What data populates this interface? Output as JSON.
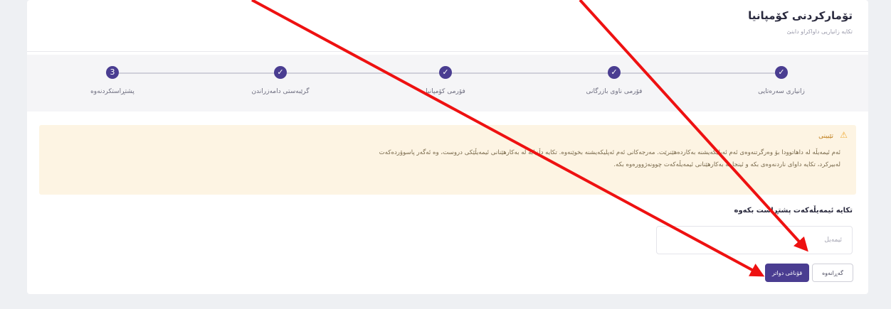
{
  "header": {
    "title": "تۆمارکردنی کۆمپانیا",
    "subtitle": "تکایە زانیاریی داواکراو دابنێ"
  },
  "steps": [
    {
      "label": "زانیاری سەرەتایی",
      "done": true,
      "mark": "✓"
    },
    {
      "label": "فۆرمی ناوی بازرگانی",
      "done": true,
      "mark": "✓"
    },
    {
      "label": "فۆرمی کۆمپانیا",
      "done": true,
      "mark": "✓"
    },
    {
      "label": "گرێبەستی دامەزراندن",
      "done": true,
      "mark": "✓"
    },
    {
      "label": "پشتڕاستکردنەوە",
      "done": false,
      "mark": "3"
    }
  ],
  "notice": {
    "title": "تێبینی",
    "body": "ئەم ئیمەیڵە لە داهاتوودا بۆ وەرگرتنەوەی ئەم ئەپلیکەیشنە بەکاردەهێنرێت. مەرجەکانی ئەم ئەپلیکەیشنە بخوێنەوە. تکایە دڵنیابە لە بەکارهێنانی ئیمەیڵێکی دروست، وە ئەگەر پاسوۆردەکەت لەبیرکرد، تکایە داوای ناردنەوەی بکە و ئینجا بە بەکارهێنانی ئیمەیڵەکەت چوونەژوورەوە بکە."
  },
  "question": "تکایە ئیمەیڵەکەت پشتڕاست بکەوە",
  "form": {
    "email_value": "",
    "email_placeholder": "ئیمەیڵ"
  },
  "buttons": {
    "next_label": "قۆناغی دواتر",
    "back_label": "گەڕانەوە"
  },
  "colors": {
    "accent": "#4a3d91",
    "annotation_arrow": "#ee1111",
    "notice_bg": "#fdf4e3"
  },
  "icons": {
    "step_done": "check-icon",
    "notice": "warning-icon"
  }
}
